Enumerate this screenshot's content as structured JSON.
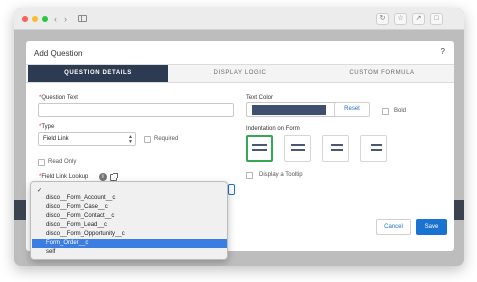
{
  "colors": {
    "header_tab": "#2d3b52",
    "text_color_swatch": "#3f4f70",
    "save": "#1b73d1",
    "highlight": "#3b7de0",
    "selected_indent": "#34a853"
  },
  "browser": {
    "back_icon": "chevron-left-icon",
    "forward_icon": "chevron-right-icon",
    "toolbar_icons": [
      "refresh-icon",
      "star-icon",
      "share-icon",
      "tabs-icon"
    ]
  },
  "modal": {
    "title": "Add Question",
    "help": "?",
    "tabs": [
      "QUESTION DETAILS",
      "DISPLAY LOGIC",
      "CUSTOM FORMULA"
    ],
    "active_tab": "QUESTION DETAILS"
  },
  "form": {
    "question_text": {
      "required_mark": "*",
      "label": "Question Text",
      "value": ""
    },
    "type": {
      "required_mark": "*",
      "label": "Type",
      "value": "Field Link"
    },
    "required": {
      "label": "Required",
      "checked": false
    },
    "read_only": {
      "label": "Read Only",
      "checked": false
    },
    "field_link_lookup": {
      "required_mark": "*",
      "label": "Field Link Lookup",
      "info": "i"
    },
    "text_color": {
      "label": "Text Color",
      "reset": "Reset"
    },
    "bold": {
      "label": "Bold",
      "checked": false
    },
    "indentation": {
      "label": "Indentation on Form",
      "selected_index": 0
    },
    "tooltip": {
      "label": "Display a Tooltip",
      "checked": false
    }
  },
  "dropdown": {
    "check": "✓",
    "options": [
      "",
      "disco__Form_Account__c",
      "disco__Form_Case__c",
      "disco__Form_Contact__c",
      "disco__Form_Lead__c",
      "disco__Form_Opportunity__c",
      "Form_Order__c",
      "self"
    ],
    "highlighted": "Form_Order__c"
  },
  "footer": {
    "cancel": "Cancel",
    "save": "Save"
  }
}
